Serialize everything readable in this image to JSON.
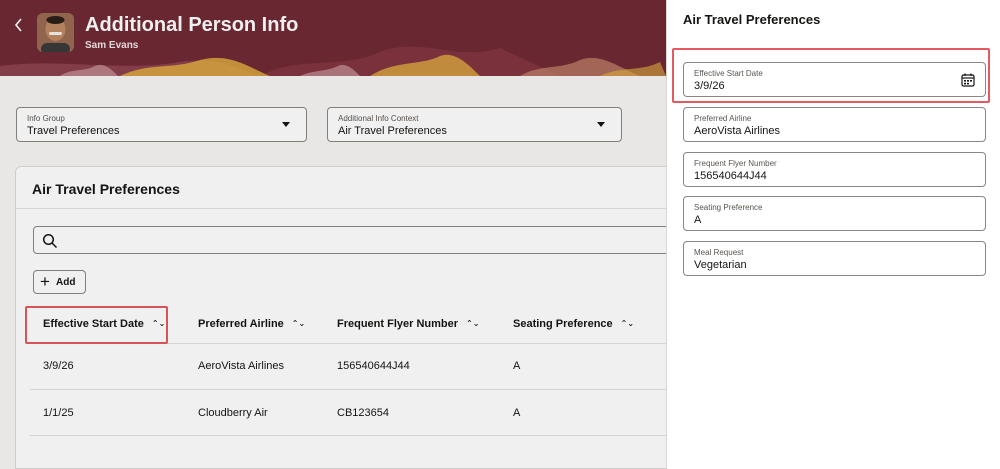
{
  "header": {
    "title": "Additional Person Info",
    "subtitle": "Sam Evans",
    "back_icon": "chevron-left-icon",
    "colors": {
      "banner": "#6f2a35"
    }
  },
  "filters": {
    "info_group": {
      "label": "Info Group",
      "value": "Travel Preferences"
    },
    "info_context": {
      "label": "Additional Info Context",
      "value": "Air Travel Preferences"
    }
  },
  "section": {
    "title": "Air Travel Preferences",
    "search_icon": "search-icon",
    "add_label": "Add"
  },
  "table": {
    "columns": [
      "Effective Start Date",
      "Preferred Airline",
      "Frequent Flyer Number",
      "Seating Preference"
    ],
    "rows": [
      [
        "3/9/26",
        "AeroVista Airlines",
        "156540644J44",
        "A"
      ],
      [
        "1/1/25",
        "Cloudberry Air",
        "CB123654",
        "A"
      ]
    ]
  },
  "drawer": {
    "title": "Air Travel Preferences",
    "fields": [
      {
        "label": "Effective Start Date",
        "value": "3/9/26",
        "icon": "calendar-icon"
      },
      {
        "label": "Preferred Airline",
        "value": "AeroVista Airlines"
      },
      {
        "label": "Frequent Flyer Number",
        "value": "156540644J44"
      },
      {
        "label": "Seating Preference",
        "value": "A"
      },
      {
        "label": "Meal Request",
        "value": "Vegetarian"
      }
    ]
  },
  "colors": {
    "highlight": "#e35a60",
    "field_border": "#8b8682"
  }
}
